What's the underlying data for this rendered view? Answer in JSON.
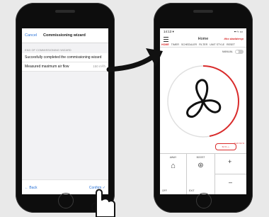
{
  "left_phone": {
    "cancel": "Cancel",
    "title": "Commissioning wizard",
    "section_label": "END OF COMMISSIONING WIZARD",
    "message": "Succesfully completed the commissioning wizard",
    "measure_label": "Measured maximum air flow",
    "measure_value": "150 m³/h",
    "back": "← Back",
    "confirm": "Confirm ✓"
  },
  "right_phone": {
    "time": "14:13 ▾",
    "signal": "▪▪ ≈ ▭",
    "title": "Home",
    "logo": "itho daalderop",
    "tabs": [
      {
        "label": "HOME",
        "active": true
      },
      {
        "label": "TIMER"
      },
      {
        "label": "SCHEDULER"
      },
      {
        "label": "FILTER"
      },
      {
        "label": "UNIT STYLE"
      },
      {
        "label": "RESET"
      }
    ],
    "manual_label": "MANUAL",
    "speed_pill": "64 % -•- ",
    "speed_label": "Exch 64 %",
    "buttons": {
      "away": "AWAY",
      "boost": "BOOST",
      "off": "OFF",
      "exit": "EXIT",
      "plus": "+",
      "minus": "–"
    }
  },
  "colors": {
    "accent": "#d92b2b",
    "link": "#2b73d6"
  }
}
